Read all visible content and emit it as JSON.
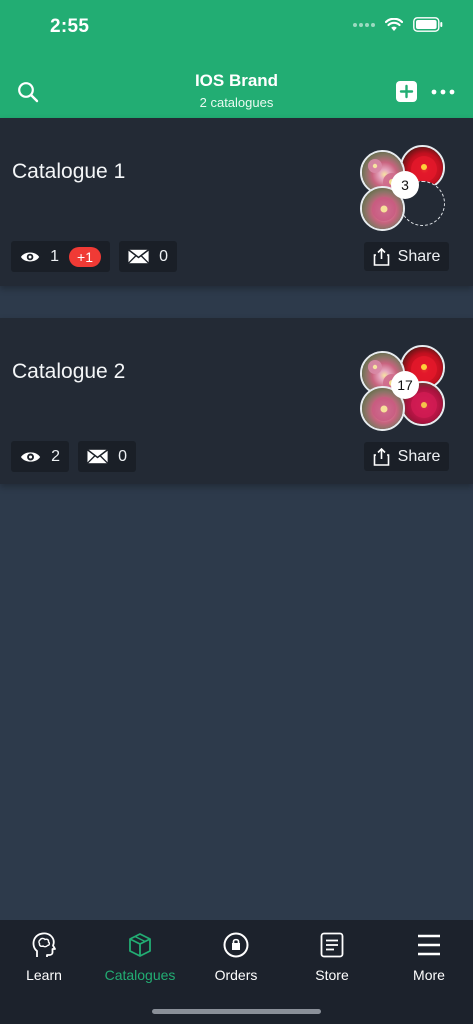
{
  "status_bar": {
    "time": "2:55"
  },
  "header": {
    "title": "IOS Brand",
    "subtitle": "2 catalogues"
  },
  "catalogues": [
    {
      "title": "Catalogue 1",
      "views": "1",
      "new_views_badge": "+1",
      "messages": "0",
      "photo_count": "3",
      "share_label": "Share"
    },
    {
      "title": "Catalogue 2",
      "views": "2",
      "messages": "0",
      "photo_count": "17",
      "share_label": "Share"
    }
  ],
  "tabs": [
    {
      "label": "Learn",
      "icon": "brain-head-icon",
      "active": false
    },
    {
      "label": "Catalogues",
      "icon": "box-icon",
      "active": true
    },
    {
      "label": "Orders",
      "icon": "bag-circle-icon",
      "active": false
    },
    {
      "label": "Store",
      "icon": "list-document-icon",
      "active": false
    },
    {
      "label": "More",
      "icon": "hamburger-menu-icon",
      "active": false
    }
  ],
  "colors": {
    "brand_green": "#22ad73",
    "badge_red": "#f03a35",
    "background": "#2d3a4b",
    "card": "#232a35"
  }
}
